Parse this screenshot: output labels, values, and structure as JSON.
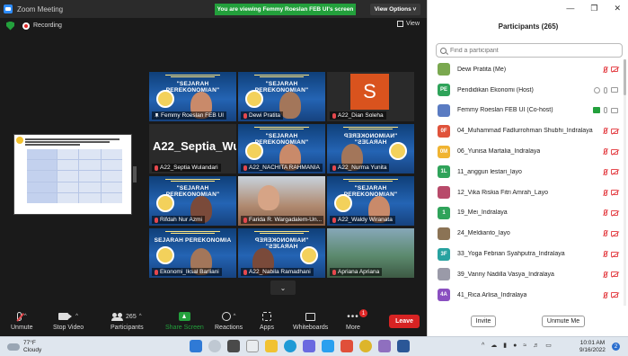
{
  "window": {
    "title": "Zoom Meeting",
    "viewing_banner": "You are viewing Femmy Roeslan FEB UI's screen",
    "view_options": "View Options ˅",
    "recording_label": "Recording",
    "view_label": "View"
  },
  "tiles": [
    {
      "name": "Femmy Roeslan FEB UI",
      "banner": "\"SEJARAH PEREKONOMIAN\"",
      "kind": "banner",
      "active": true,
      "icon": "pin"
    },
    {
      "name": "Dewi Pratita",
      "banner": "\"SEJARAH PEREKONOMIAN\"",
      "kind": "banner",
      "icon": "mute"
    },
    {
      "name": "A22_Dian Soleha",
      "avatar_letter": "S",
      "kind": "avatar",
      "icon": "mute"
    },
    {
      "name": "A22_Septia Wulandari",
      "big_name": "A22_Septia_Wul...",
      "kind": "name",
      "icon": "mute"
    },
    {
      "name": "A22_NACHITA RAHMANIA",
      "banner": "\"SEJARAH PEREKONOMIAN\"",
      "kind": "banner",
      "icon": "mute"
    },
    {
      "name": "A22_Nurma Yunita",
      "banner": "\"NAIMONOKEREP HARAJES\"",
      "kind": "banner-mirror",
      "icon": "mute"
    },
    {
      "name": "Rifdah Nur Azmi",
      "banner": "\"SEJARAH PEREKONOMIAN\"",
      "kind": "banner",
      "icon": "mute"
    },
    {
      "name": "Farida R. Wargadalem-Un...",
      "kind": "photo",
      "icon": "mute"
    },
    {
      "name": "A22_Waldy Wiranata",
      "banner": "\"SEJARAH PEREKONOMIAN\"",
      "kind": "banner",
      "icon": "mute"
    },
    {
      "name": "Ekonomi_Iksal Barliani",
      "banner": "SEJARAH PEREKONOMIA",
      "kind": "banner",
      "icon": "mute"
    },
    {
      "name": "A22_Nabila Ramadhani",
      "banner": "\"NAIMONOKEREP HARAJES\"",
      "kind": "banner-mirror",
      "icon": "mute"
    },
    {
      "name": "Apriana Apriana",
      "kind": "photo2",
      "icon": "mute"
    }
  ],
  "toolbar": {
    "unmute": "Unmute",
    "stop_video": "Stop Video",
    "participants": "Participants",
    "participants_count": "265",
    "share_screen": "Share Screen",
    "reactions": "Reactions",
    "apps": "Apps",
    "whiteboards": "Whiteboards",
    "more": "More",
    "more_badge": "1",
    "leave": "Leave"
  },
  "panel": {
    "title": "Participants (265)",
    "search_placeholder": "Find a participant",
    "participants": [
      {
        "initials": "",
        "name": "Dewi Pratita (Me)",
        "color": "#7aa84f",
        "icons": [
          "mic-off",
          "cam-off"
        ]
      },
      {
        "initials": "PE",
        "name": "Pendidikan Ekonomi (Host)",
        "color": "#2fa35a",
        "icons": [
          "rec",
          "mic-on",
          "cam-on"
        ]
      },
      {
        "initials": "",
        "name": "Femmy Roeslan FEB UI (Co-host)",
        "color": "#5a7bc2",
        "icons": [
          "share",
          "mic-on",
          "cam-on"
        ]
      },
      {
        "initials": "0F",
        "name": "04_Muhammad Fadlurrohman Shubhi_Indralaya",
        "color": "#e0533b",
        "icons": [
          "mic-off",
          "cam-off"
        ]
      },
      {
        "initials": "0M",
        "name": "06_Yunisa Martalia_Indralaya",
        "color": "#f0b432",
        "icons": [
          "mic-off",
          "cam-off"
        ]
      },
      {
        "initials": "1L",
        "name": "11_anggun lestari_layo",
        "color": "#2fa35a",
        "icons": [
          "mic-off",
          "cam-off"
        ]
      },
      {
        "initials": "",
        "name": "12_Vika Riskia Fitri Amrah_Layo",
        "color": "#b84a6a",
        "icons": [
          "mic-off",
          "cam-off"
        ]
      },
      {
        "initials": "1",
        "name": "19_Mei_Indralaya",
        "color": "#2fa35a",
        "icons": [
          "mic-off",
          "cam-off"
        ]
      },
      {
        "initials": "",
        "name": "24_Meldianto_layo",
        "color": "#8b7355",
        "icons": [
          "mic-off",
          "cam-off"
        ]
      },
      {
        "initials": "3F",
        "name": "33_Yoga Febrian Syahputra_Indralaya",
        "color": "#27a2a0",
        "icons": [
          "mic-off",
          "cam-off"
        ]
      },
      {
        "initials": "",
        "name": "39_Vanny Nadilla Vasya_Indralaya",
        "color": "#9a9aa8",
        "icons": [
          "mic-off",
          "cam-off"
        ]
      },
      {
        "initials": "4A",
        "name": "41_Rica Arlisa_Indralaya",
        "color": "#8a4fc0",
        "icons": [
          "mic-off",
          "cam-off"
        ]
      }
    ],
    "invite": "Invite",
    "unmute_me": "Unmute Me"
  },
  "taskbar": {
    "temperature": "77°F",
    "weather": "Cloudy",
    "time": "10:01 AM",
    "date": "9/16/2022",
    "notifications": "2"
  }
}
